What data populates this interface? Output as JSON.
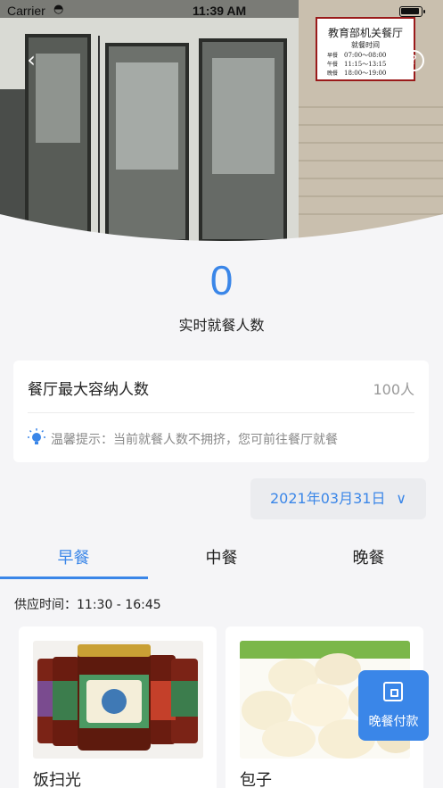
{
  "status_bar": {
    "carrier": "Carrier",
    "time": "11:39 AM"
  },
  "hero": {
    "sign_title": "教育部机关餐厅",
    "sign_subtitle": "就餐时间",
    "sign_rows": [
      {
        "meal": "早餐",
        "time": "07:00～08:00"
      },
      {
        "meal": "午餐",
        "time": "11:15～13:15"
      },
      {
        "meal": "晚餐",
        "time": "18:00～19:00"
      }
    ]
  },
  "realtime": {
    "count": "0",
    "label": "实时就餐人数"
  },
  "capacity": {
    "label": "餐厅最大容纳人数",
    "value": "100人",
    "tip": "温馨提示：当前就餐人数不拥挤，您可前往餐厅就餐"
  },
  "date_selector": {
    "value": "2021年03月31日"
  },
  "tabs": [
    {
      "label": "早餐",
      "active": true
    },
    {
      "label": "中餐",
      "active": false
    },
    {
      "label": "晚餐",
      "active": false
    }
  ],
  "supply_time": "供应时间：11:30 - 16:45",
  "foods": [
    {
      "name": "饭扫光"
    },
    {
      "name": "包子"
    }
  ],
  "pay_button": {
    "label": "晚餐付款"
  },
  "colors": {
    "accent": "#3a86e8",
    "background": "#f5f5f7"
  }
}
